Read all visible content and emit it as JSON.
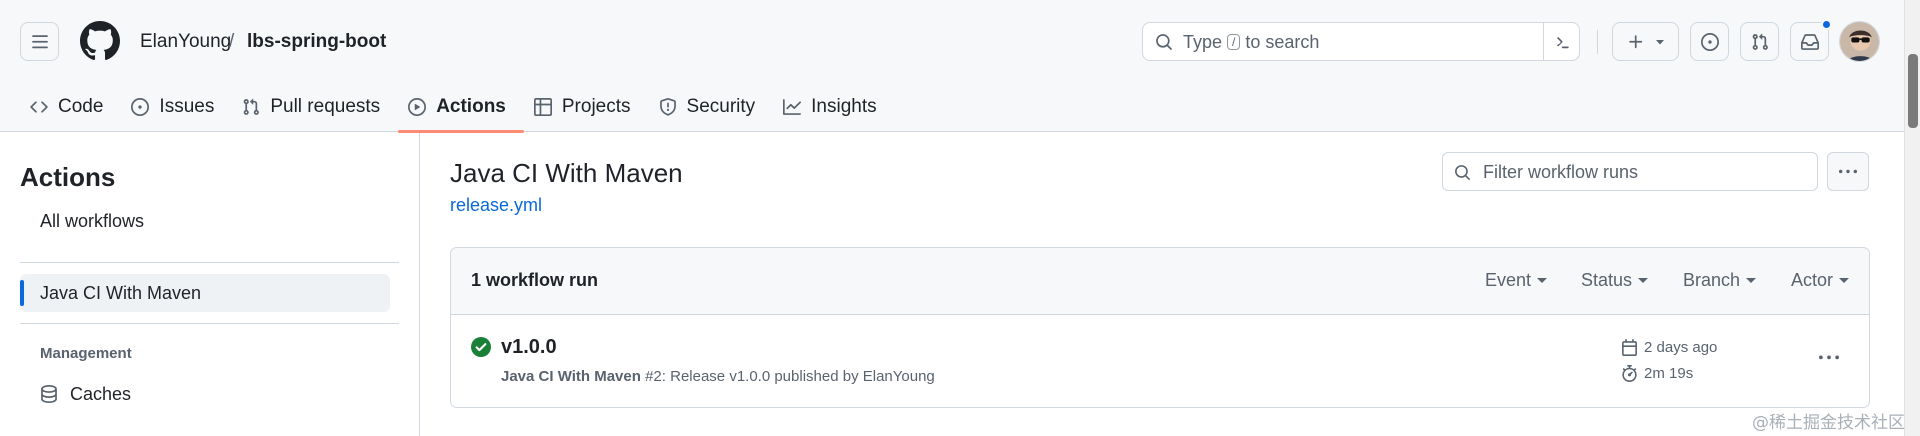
{
  "header": {
    "owner": "ElanYoung",
    "separator": "/",
    "repo": "lbs-spring-boot",
    "search": {
      "prefix": "Type",
      "key": "/",
      "suffix": "to search"
    }
  },
  "tabs": [
    {
      "label": "Code",
      "icon": "code-icon"
    },
    {
      "label": "Issues",
      "icon": "issue-opened-icon"
    },
    {
      "label": "Pull requests",
      "icon": "git-pull-request-icon"
    },
    {
      "label": "Actions",
      "icon": "play-icon",
      "active": true
    },
    {
      "label": "Projects",
      "icon": "table-icon"
    },
    {
      "label": "Security",
      "icon": "shield-icon"
    },
    {
      "label": "Insights",
      "icon": "graph-icon"
    }
  ],
  "sidebar": {
    "title": "Actions",
    "all_workflows": "All workflows",
    "active_workflow": "Java CI With Maven",
    "section_management": "Management",
    "caches": "Caches"
  },
  "workflow": {
    "title": "Java CI With Maven",
    "file": "release.yml",
    "filter_placeholder": "Filter workflow runs"
  },
  "runs": {
    "count_label": "1 workflow run",
    "filters": [
      "Event",
      "Status",
      "Branch",
      "Actor"
    ],
    "items": [
      {
        "title": "v1.0.0",
        "workflow_name": "Java CI With Maven",
        "detail": "#2: Release v1.0.0 published by ElanYoung",
        "date": "2 days ago",
        "duration": "2m 19s",
        "status": "success"
      }
    ]
  },
  "watermark": "@稀土掘金技术社区",
  "colors": {
    "accent": "#0969da",
    "success": "#1a7f37",
    "active_tab_underline": "#fd8c73",
    "border": "#d0d7de",
    "muted_text": "#59636e"
  }
}
